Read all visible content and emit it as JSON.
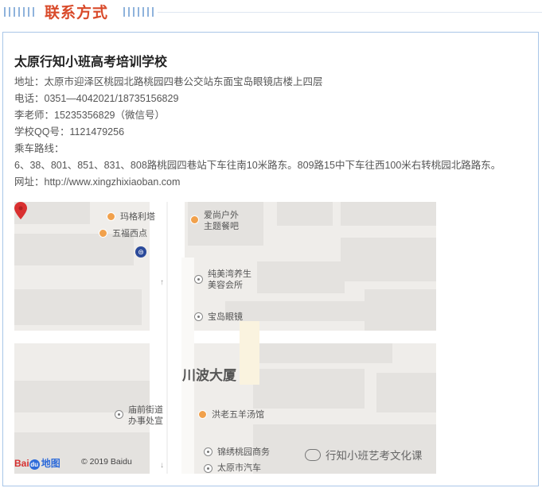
{
  "header": {
    "title": "联系方式"
  },
  "school": {
    "name": "太原行知小班高考培训学校",
    "address": "地址：太原市迎泽区桃园北路桃园四巷公交站东面宝岛眼镜店楼上四层",
    "phone": "电话：0351—4042021/18735156829",
    "teacher": "李老师：15235356829（微信号）",
    "qq": "学校QQ号：1121479256",
    "transit_label": "乘车路线：",
    "transit": "6、38、801、851、831、808路桃园四巷站下车往南10米路东。809路15中下车往西100米右转桃园北路路东。",
    "website": "网址：http://www.xingzhixiaoban.com"
  },
  "map": {
    "pois": {
      "magelite": "玛格利塔",
      "wufu": "五福西点",
      "aishang": "爱尚户外\n主题餐吧",
      "chunmeiwan": "纯美湾养生\n美容会所",
      "baodao": "宝岛眼镜",
      "miaoqian": "庙前街道\n办事处宣",
      "hongsan": "洪老五羊汤馆",
      "jinxiu": "锦绣桃园商务",
      "qiche": "太原市汽车"
    },
    "building": "川波大厦",
    "logo_bai": "Bai",
    "logo_du": "du",
    "logo_ditu": "地图",
    "copyright": "© 2019 Baidu",
    "watermark": "行知小班艺考文化课"
  },
  "colors": {
    "heading": "#d94a2a",
    "border": "#a9c6e8",
    "pin": "#d93030",
    "map_bg": "#efedea"
  }
}
